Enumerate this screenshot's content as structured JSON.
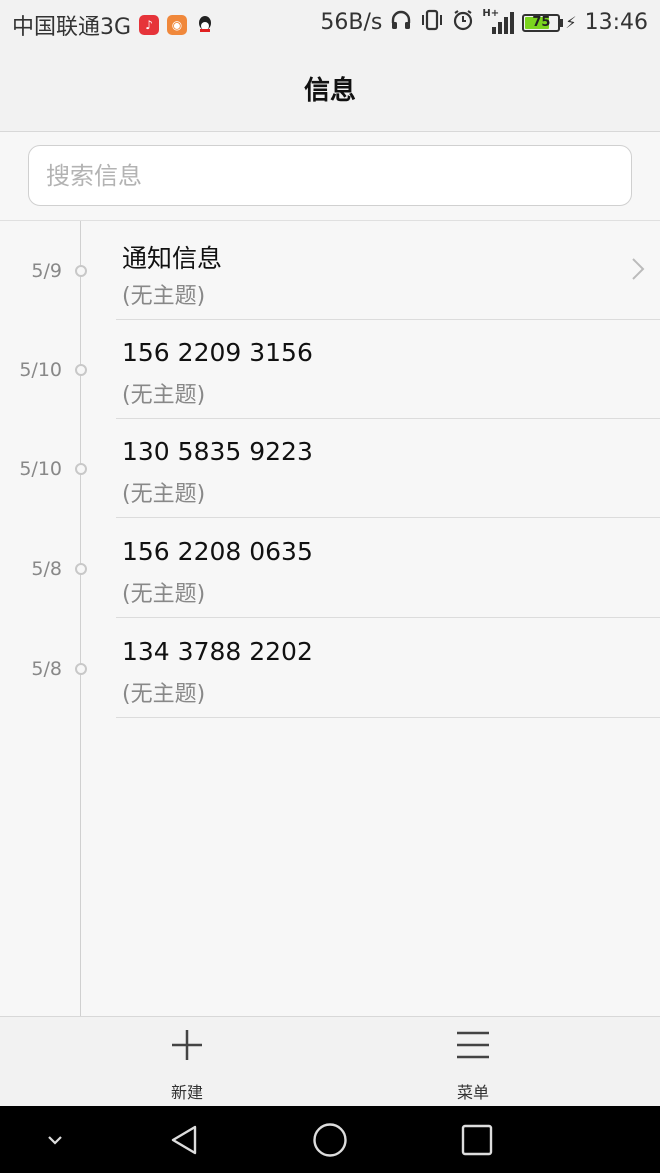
{
  "status_bar": {
    "carrier": "中国联通3G",
    "speed": "56B/s",
    "network": "H+",
    "battery_level": "75",
    "battery_fraction": 0.75,
    "time": "13:46",
    "icons": [
      "netease-music-icon",
      "weibo-icon",
      "qq-icon",
      "headphones-icon",
      "vibrate-icon",
      "alarm-icon",
      "signal-icon",
      "battery-icon",
      "charging-icon"
    ]
  },
  "header": {
    "title": "信息"
  },
  "search": {
    "placeholder": "搜索信息"
  },
  "conversations": [
    {
      "date": "5/9",
      "name": "通知信息",
      "subject": "(无主题)",
      "has_chevron": true
    },
    {
      "date": "5/10",
      "name": "156 2209 3156",
      "subject": "(无主题)",
      "has_chevron": false
    },
    {
      "date": "5/10",
      "name": "130 5835 9223",
      "subject": "(无主题)",
      "has_chevron": false
    },
    {
      "date": "5/8",
      "name": "156 2208 0635",
      "subject": "(无主题)",
      "has_chevron": false
    },
    {
      "date": "5/8",
      "name": "134 3788 2202",
      "subject": "(无主题)",
      "has_chevron": false
    }
  ],
  "actions": {
    "new_label": "新建",
    "menu_label": "菜单"
  },
  "colors": {
    "battery_fill": "#7bd41e",
    "accent_text": "#111111",
    "muted_text": "#888888"
  }
}
